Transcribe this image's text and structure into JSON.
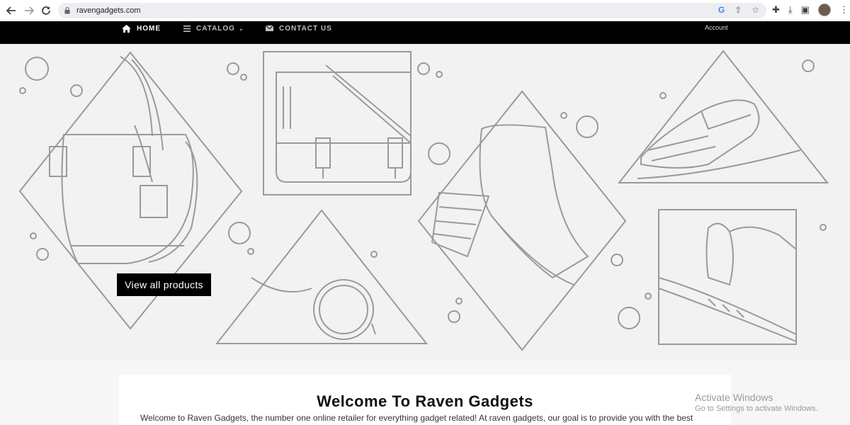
{
  "browser": {
    "url": "ravengadgets.com",
    "back_icon": "arrow-left-icon",
    "forward_icon": "arrow-right-icon",
    "reload_icon": "reload-icon"
  },
  "nav": {
    "items": [
      {
        "label": "HOME",
        "icon": "home-icon",
        "active": true
      },
      {
        "label": "CATALOG",
        "icon": "menu-icon",
        "active": false
      },
      {
        "label": "CONTACT US",
        "icon": "envelope-icon",
        "active": false
      }
    ],
    "account": "Account"
  },
  "hero": {
    "cta_label": "View all products",
    "illustrations": [
      "handbag",
      "messenger-bag",
      "ankle-boot",
      "oxford-shoe",
      "sunglasses",
      "hat-with-feather"
    ]
  },
  "welcome": {
    "title": "Welcome To Raven Gadgets",
    "text": "Welcome to Raven Gadgets, the number one online retailer for everything gadget related! At raven gadgets, our goal is to provide you with the best"
  },
  "watermark": {
    "line1": "Activate Windows",
    "line2": "Go to Settings to activate Windows."
  },
  "colors": {
    "nav_bg": "#000000",
    "hero_bg": "#f2f2f2",
    "line_art": "#9a9a9a"
  }
}
